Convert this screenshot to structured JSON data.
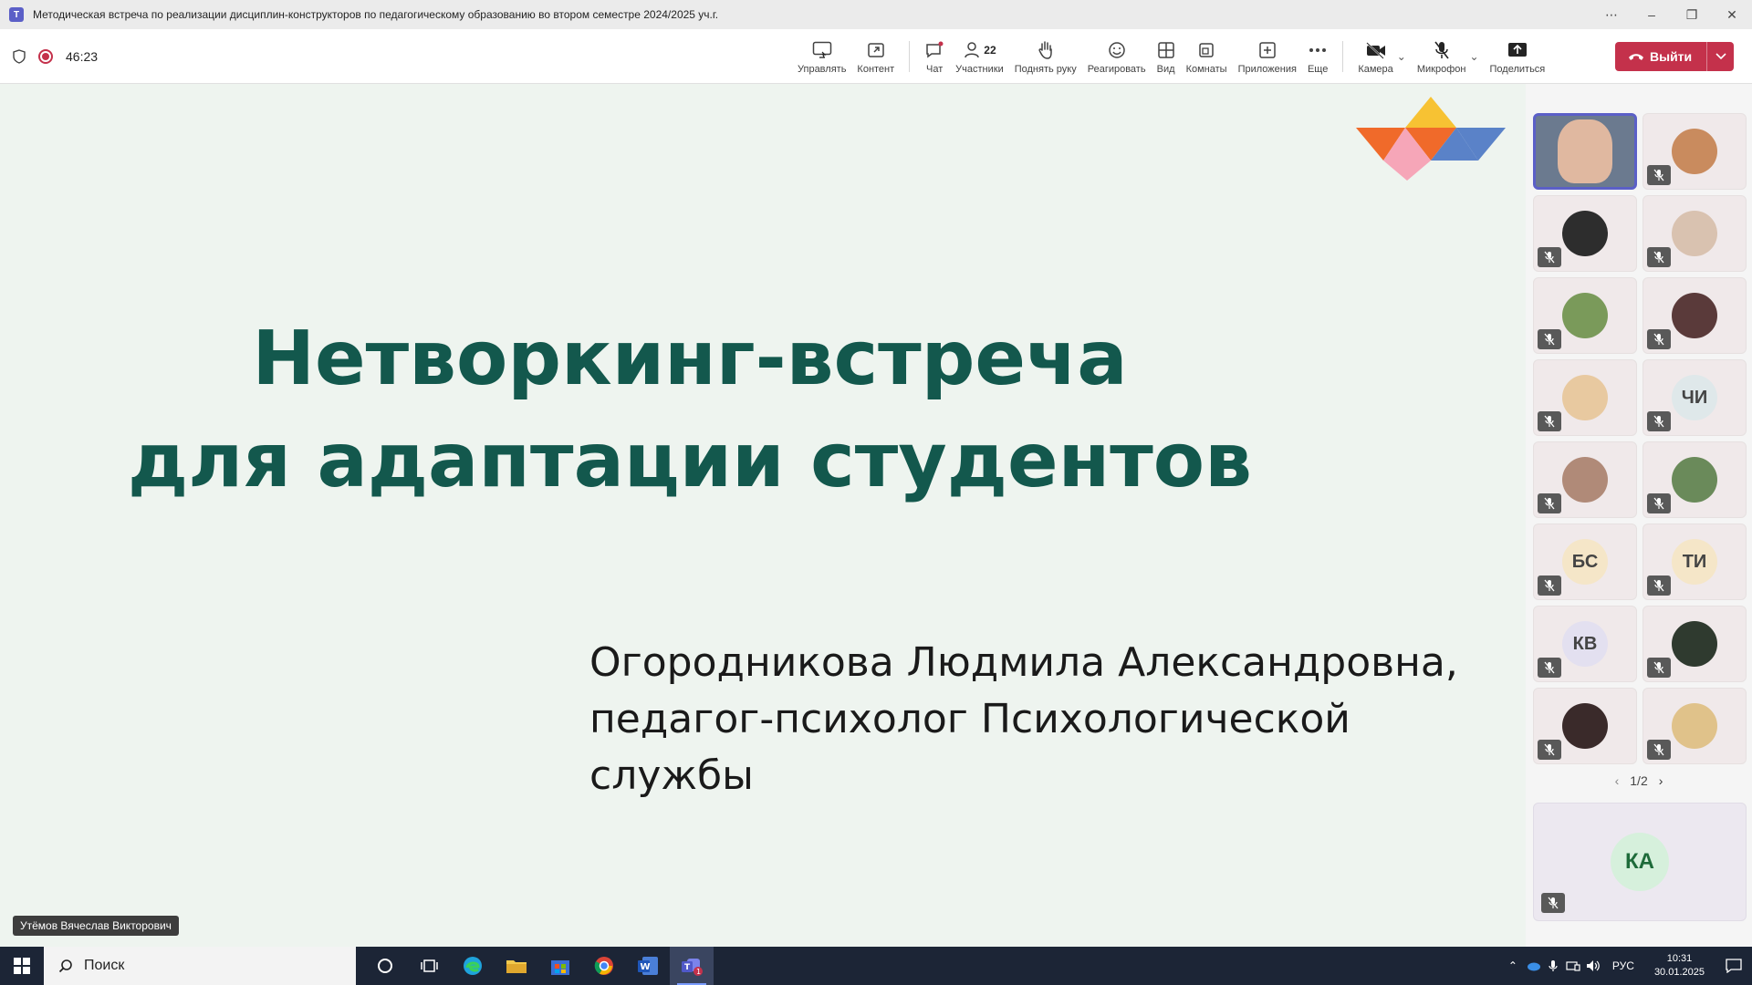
{
  "window": {
    "title": "Методическая встреча по реализации дисциплин-конструкторов по педагогическому образованию во втором семестре 2024/2025 уч.г.",
    "app_icon": "T"
  },
  "toolbar": {
    "timer": "46:23",
    "items": [
      {
        "label": "Управлять",
        "icon": "share-screen-icon"
      },
      {
        "label": "Контент",
        "icon": "content-icon"
      },
      {
        "label": "Чат",
        "icon": "chat-icon"
      },
      {
        "label": "Участники",
        "icon": "participants-icon",
        "count": "22"
      },
      {
        "label": "Поднять руку",
        "icon": "raise-hand-icon"
      },
      {
        "label": "Реагировать",
        "icon": "react-icon"
      },
      {
        "label": "Вид",
        "icon": "view-icon"
      },
      {
        "label": "Комнаты",
        "icon": "rooms-icon"
      },
      {
        "label": "Приложения",
        "icon": "apps-icon"
      },
      {
        "label": "Еще",
        "icon": "more-icon"
      },
      {
        "label": "Камера",
        "icon": "camera-off-icon"
      },
      {
        "label": "Микрофон",
        "icon": "mic-off-icon"
      },
      {
        "label": "Поделиться",
        "icon": "share-icon"
      }
    ],
    "leave_label": "Выйти"
  },
  "slide": {
    "title_line1": "Нетворкинг-встреча",
    "title_line2": "для адаптации студентов",
    "author_line1": "Огородникова Людмила Александровна,",
    "author_line2": "педагог-психолог Психологической службы",
    "title_color": "#13584d"
  },
  "speaker_name": "Утёмов Вячеслав Викторович",
  "participants": {
    "tiles": [
      {
        "initials": "",
        "kind": "photo",
        "bg": "#6b7a8f",
        "active": true,
        "muted": false
      },
      {
        "initials": "",
        "kind": "photo",
        "bg": "#c98b5e",
        "muted": true
      },
      {
        "initials": "",
        "kind": "photo",
        "bg": "#2d2d2d",
        "muted": true
      },
      {
        "initials": "",
        "kind": "photo",
        "bg": "#d9c2b0",
        "muted": true
      },
      {
        "initials": "",
        "kind": "photo",
        "bg": "#7a9a5a",
        "muted": true
      },
      {
        "initials": "",
        "kind": "photo",
        "bg": "#5a3a3a",
        "muted": true
      },
      {
        "initials": "",
        "kind": "photo",
        "bg": "#e8c9a0",
        "muted": true
      },
      {
        "initials": "ЧИ",
        "kind": "initials",
        "bg": "#dfe8ea",
        "muted": true
      },
      {
        "initials": "",
        "kind": "photo",
        "bg": "#b08a78",
        "muted": true
      },
      {
        "initials": "",
        "kind": "photo",
        "bg": "#6a8a5a",
        "muted": true
      },
      {
        "initials": "БС",
        "kind": "initials",
        "bg": "#f5e6c8",
        "muted": true
      },
      {
        "initials": "ТИ",
        "kind": "initials",
        "bg": "#f5e6c8",
        "muted": true
      },
      {
        "initials": "КВ",
        "kind": "initials",
        "bg": "#e3e0f0",
        "muted": true
      },
      {
        "initials": "",
        "kind": "photo",
        "bg": "#2f3a2f",
        "muted": true
      },
      {
        "initials": "",
        "kind": "photo",
        "bg": "#3a2a2a",
        "muted": true
      },
      {
        "initials": "",
        "kind": "photo",
        "bg": "#e0c28a",
        "muted": true
      }
    ],
    "pager": "1/2",
    "self_initials": "КА"
  },
  "taskbar": {
    "search_placeholder": "Поиск",
    "apps": [
      "cortana-icon",
      "task-view-icon",
      "edge-icon",
      "explorer-icon",
      "store-icon",
      "chrome-icon",
      "word-icon",
      "teams-icon"
    ],
    "lang": "РУС",
    "time": "10:31",
    "date": "30.01.2025",
    "teams_badge": "1"
  }
}
